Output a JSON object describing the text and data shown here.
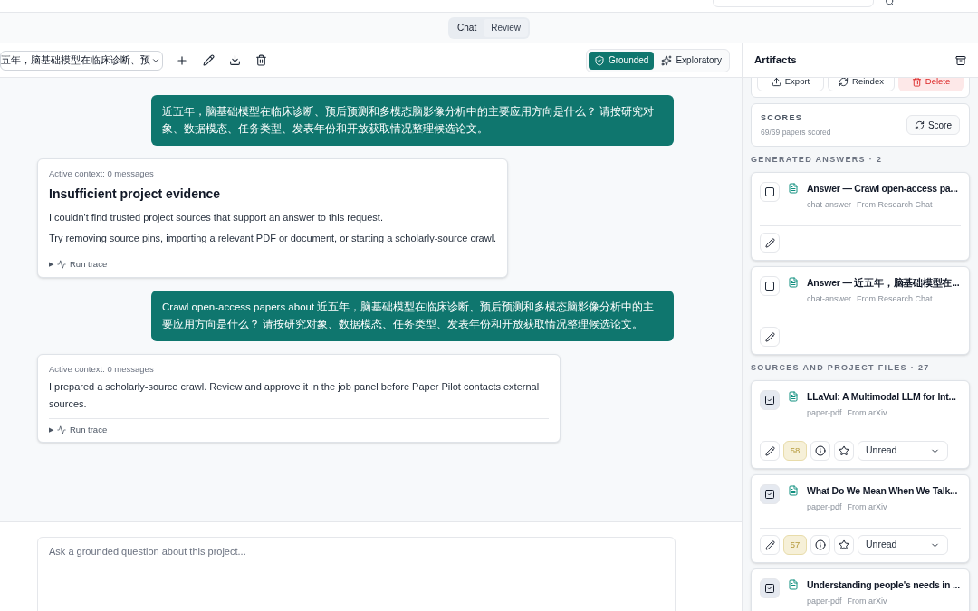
{
  "view_tabs": [
    {
      "label": "Chat",
      "selected": true
    },
    {
      "label": "Review",
      "selected": false
    }
  ],
  "toolbar": {
    "conversation": "五年，脑基础模型在临床诊断、预",
    "modes": [
      {
        "label": "Grounded",
        "selected": true,
        "kind": "grounded"
      },
      {
        "label": "Exploratory",
        "selected": false,
        "kind": "exploratory"
      }
    ]
  },
  "messages": [
    {
      "kind": "user",
      "text": "近五年，脑基础模型在临床诊断、预后预测和多模态脑影像分析中的主要应用方向是什么？ 请按研究对象、数据模态、任务类型、发表年份和开放获取情况整理候选论文。"
    },
    {
      "kind": "assistant",
      "context": "Active context: 0 messages",
      "title": "Insufficient project evidence",
      "paragraphs": [
        "I couldn't find trusted project sources that support an answer to this request.",
        "Try removing source pins, importing a relevant PDF or document, or starting a scholarly-source crawl."
      ],
      "marker": "▶",
      "trace": "Run trace"
    },
    {
      "kind": "user",
      "text": "Crawl open-access papers about 近五年，脑基础模型在临床诊断、预后预测和多模态脑影像分析中的主要应用方向是什么？ 请按研究对象、数据模态、任务类型、发表年份和开放获取情况整理候选论文。"
    },
    {
      "kind": "assistant",
      "context": "Active context: 0 messages",
      "paragraphs": [
        "I prepared a scholarly-source crawl. Review and approve it in the job panel before Paper Pilot contacts external sources."
      ],
      "marker": "▶",
      "trace": "Run trace"
    }
  ],
  "composer": {
    "placeholder": "Ask a grounded question about this project..."
  },
  "artifacts": {
    "title": "Artifacts",
    "actions": [
      {
        "label": "Export",
        "kind": "export"
      },
      {
        "label": "Reindex",
        "kind": "reindex"
      },
      {
        "label": "Delete",
        "kind": "delete"
      }
    ],
    "scores": {
      "heading": "SCORES",
      "detail": "69/69 papers scored",
      "button": "Score"
    },
    "sections": [
      {
        "heading": "GENERATED ANSWERS · 2",
        "items": [
          {
            "title": "Answer — Crawl open-access pa...",
            "type": "chat-answer",
            "source": "From Research Chat",
            "checked": false
          },
          {
            "title": "Answer — 近五年，脑基础模型在...",
            "type": "chat-answer",
            "source": "From Research Chat",
            "checked": false
          }
        ]
      },
      {
        "heading": "SOURCES AND PROJECT FILES · 27",
        "items": [
          {
            "title": "LLaVul: A Multimodal LLM for Int...",
            "type": "paper-pdf",
            "source": "From arXiv",
            "checked": true,
            "score": "58",
            "starred": false,
            "status": "Unread"
          },
          {
            "title": "What Do We Mean When We Talk...",
            "type": "paper-pdf",
            "source": "From arXiv",
            "checked": true,
            "score": "57",
            "starred": false,
            "status": "Unread"
          },
          {
            "title": "Understanding people's needs in ...",
            "type": "paper-pdf",
            "source": "From arXiv",
            "checked": true
          }
        ]
      }
    ]
  }
}
